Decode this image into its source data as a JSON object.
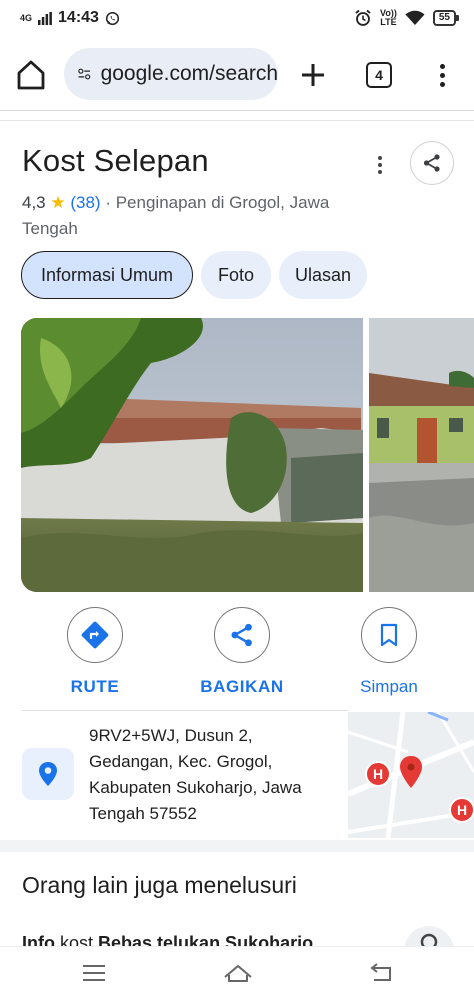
{
  "status_bar": {
    "network": "4G",
    "time": "14:43",
    "volte": "Vo))",
    "lte": "LTE",
    "battery": "55"
  },
  "browser": {
    "url": "google.com/search",
    "tab_count": "4"
  },
  "place": {
    "title": "Kost Selepan",
    "rating": "4,3",
    "star": "★",
    "review_count": "(38)",
    "category_location": "· Penginapan di Grogol, Jawa Tengah"
  },
  "tabs": [
    {
      "label": "Informasi Umum",
      "active": true
    },
    {
      "label": "Foto",
      "active": false
    },
    {
      "label": "Ulasan",
      "active": false
    }
  ],
  "actions": {
    "route": "RUTE",
    "share": "BAGIKAN",
    "save": "Simpan"
  },
  "address": {
    "lines": [
      "9RV2+5WJ, Dusun 2,",
      "Gedangan, Kec. Grogol,",
      "Kabupaten Sukoharjo, Jawa",
      "Tengah 57552"
    ],
    "map_marker": "H"
  },
  "related": {
    "title": "Orang lain juga menelusuri",
    "peek_prefix": "Info",
    "peek_middle": " kost ",
    "peek_suffix": "Bebas telukan Sukoharjo"
  },
  "colors": {
    "accent": "#1a73e8",
    "chip_active": "#d3e3fd",
    "chip": "#e8effa",
    "star": "#fbbc04",
    "pin": "#e53935"
  }
}
